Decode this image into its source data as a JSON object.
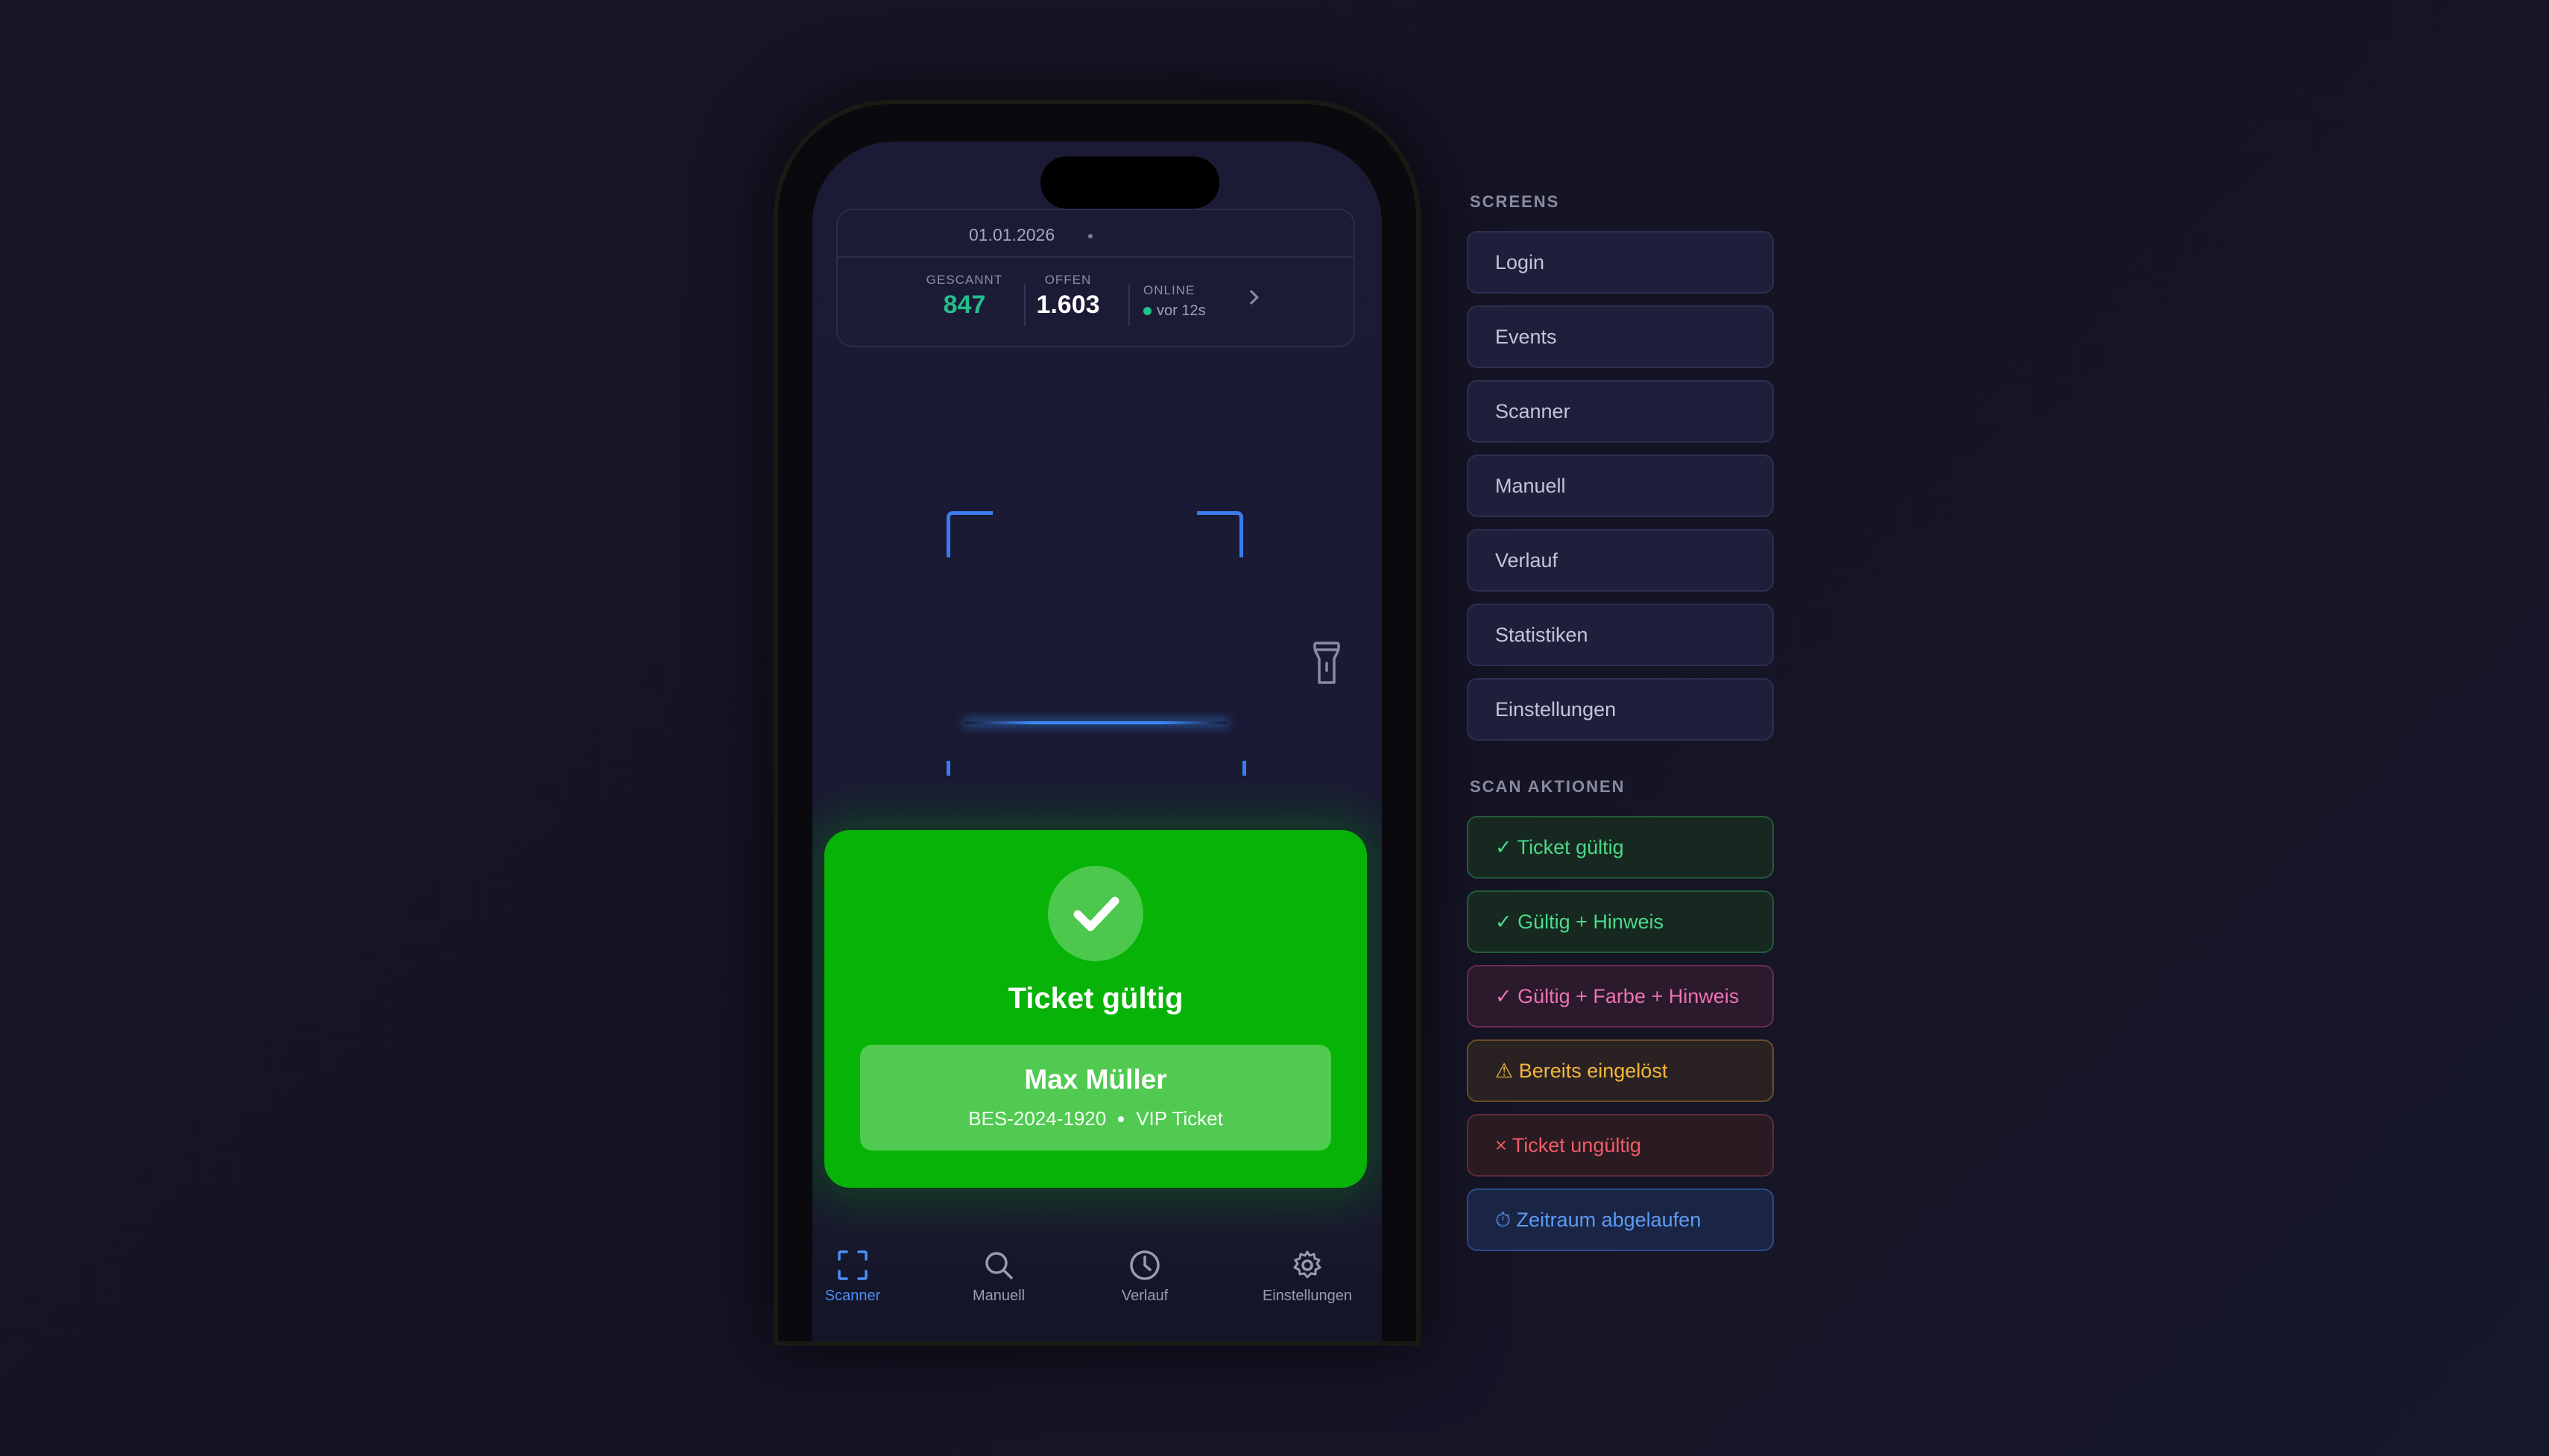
{
  "header": {
    "date": "01.01.2026",
    "stats": {
      "scanned_label": "GESCANNT",
      "scanned_value": "847",
      "open_label": "OFFEN",
      "open_value": "1.603",
      "online_label": "ONLINE",
      "online_text": "vor 12s"
    }
  },
  "result": {
    "title": "Ticket gültig",
    "name": "Max Müller",
    "ticket_id": "BES-2024-1920",
    "ticket_type": "VIP Ticket",
    "color": "#07b307"
  },
  "tabs": [
    {
      "label": "Scanner",
      "icon": "scan-frame-icon",
      "active": true
    },
    {
      "label": "Manuell",
      "icon": "search-icon",
      "active": false
    },
    {
      "label": "Verlauf",
      "icon": "clock-icon",
      "active": false
    },
    {
      "label": "Einstellungen",
      "icon": "gear-icon",
      "active": false
    }
  ],
  "panel": {
    "screens_title": "SCREENS",
    "screens": [
      "Login",
      "Events",
      "Scanner",
      "Manuell",
      "Verlauf",
      "Statistiken",
      "Einstellungen"
    ],
    "actions_title": "SCAN AKTIONEN",
    "actions": [
      {
        "label": "✓ Ticket gültig",
        "color": "#4cd98a"
      },
      {
        "label": "✓ Gültig + Hinweis",
        "color": "#4cd98a"
      },
      {
        "label": "✓ Gültig + Farbe + Hinweis",
        "color": "#ee72b4"
      },
      {
        "label": "⚠ Bereits eingelöst",
        "color": "#f4b73c"
      },
      {
        "label": "× Ticket ungültig",
        "color": "#f05c66"
      },
      {
        "label": "⏱ Zeitraum abgelaufen",
        "color": "#5c9cf5"
      }
    ]
  }
}
